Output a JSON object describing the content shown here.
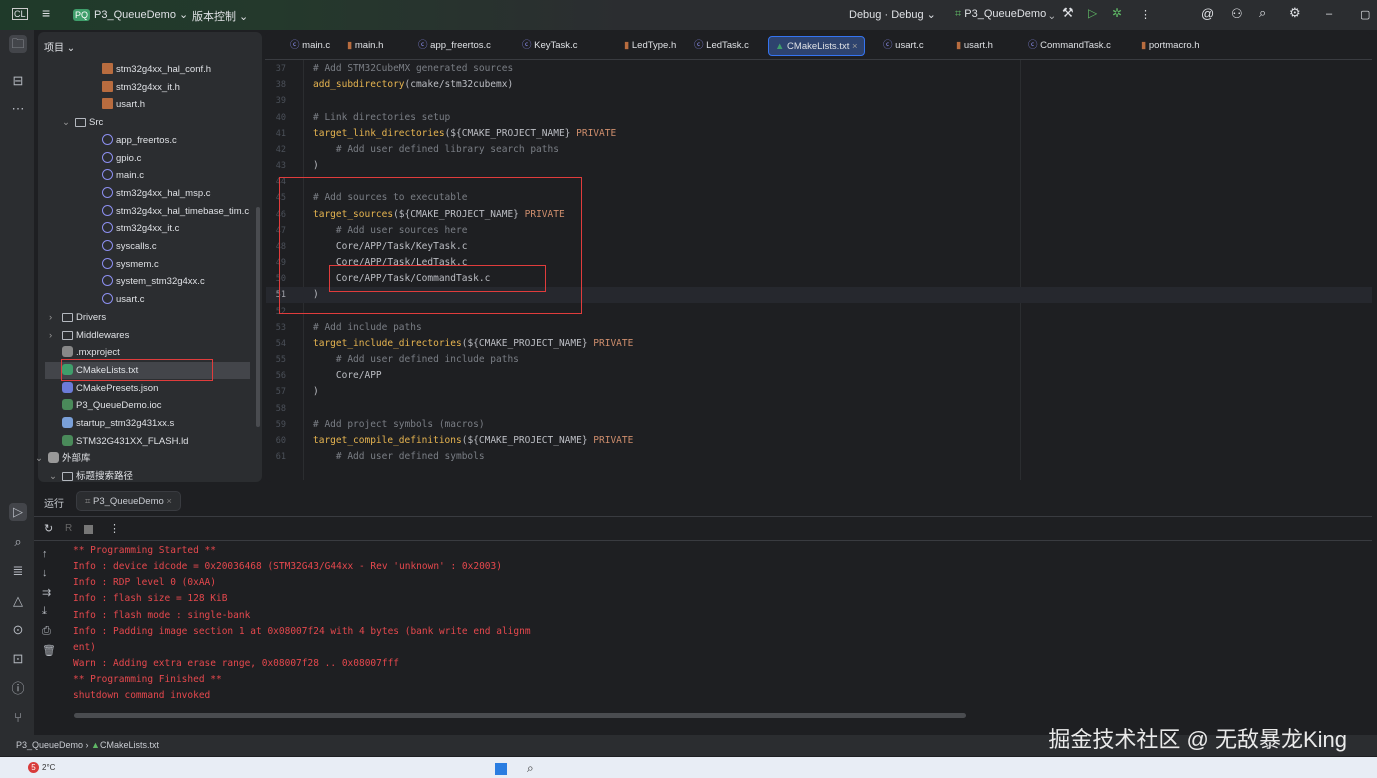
{
  "titlebar": {
    "project": "P3_QueueDemo",
    "vcs": "版本控制",
    "config": "Debug · Debug",
    "run_target": "P3_QueueDemo"
  },
  "project_panel": {
    "title": "项目",
    "items": [
      {
        "label": "stm32g4xx_hal_conf.h",
        "type": "h",
        "indent": 3
      },
      {
        "label": "stm32g4xx_it.h",
        "type": "h",
        "indent": 3
      },
      {
        "label": "usart.h",
        "type": "h",
        "indent": 3
      },
      {
        "label": "Src",
        "type": "folder",
        "indent": 2,
        "expanded": true
      },
      {
        "label": "app_freertos.c",
        "type": "c",
        "indent": 3
      },
      {
        "label": "gpio.c",
        "type": "c",
        "indent": 3
      },
      {
        "label": "main.c",
        "type": "c",
        "indent": 3
      },
      {
        "label": "stm32g4xx_hal_msp.c",
        "type": "c",
        "indent": 3
      },
      {
        "label": "stm32g4xx_hal_timebase_tim.c",
        "type": "c",
        "indent": 3
      },
      {
        "label": "stm32g4xx_it.c",
        "type": "c",
        "indent": 3
      },
      {
        "label": "syscalls.c",
        "type": "c",
        "indent": 3
      },
      {
        "label": "sysmem.c",
        "type": "c",
        "indent": 3
      },
      {
        "label": "system_stm32g4xx.c",
        "type": "c",
        "indent": 3
      },
      {
        "label": "usart.c",
        "type": "c",
        "indent": 3
      },
      {
        "label": "Drivers",
        "type": "folder",
        "indent": 1,
        "expanded": false
      },
      {
        "label": "Middlewares",
        "type": "folder",
        "indent": 1,
        "expanded": false
      },
      {
        "label": ".mxproject",
        "type": "text",
        "indent": 1
      },
      {
        "label": "CMakeLists.txt",
        "type": "cmake",
        "indent": 1,
        "selected": true
      },
      {
        "label": "CMakePresets.json",
        "type": "json",
        "indent": 1
      },
      {
        "label": "P3_QueueDemo.ioc",
        "type": "ioc",
        "indent": 1
      },
      {
        "label": "startup_stm32g431xx.s",
        "type": "asm",
        "indent": 1
      },
      {
        "label": "STM32G431XX_FLASH.ld",
        "type": "ld",
        "indent": 1
      },
      {
        "label": "外部库",
        "type": "lib",
        "indent": 0,
        "expanded": true
      },
      {
        "label": "标题搜索路径",
        "type": "folder",
        "indent": 1,
        "expanded": true
      }
    ]
  },
  "tabs": [
    {
      "label": "main.c",
      "type": "c"
    },
    {
      "label": "main.h",
      "type": "h"
    },
    {
      "label": "app_freertos.c",
      "type": "c"
    },
    {
      "label": "KeyTask.c",
      "type": "c"
    },
    {
      "label": "LedType.h",
      "type": "h"
    },
    {
      "label": "LedTask.c",
      "type": "c"
    },
    {
      "label": "CMakeLists.txt",
      "type": "cmake",
      "active": true
    },
    {
      "label": "usart.c",
      "type": "c"
    },
    {
      "label": "usart.h",
      "type": "h"
    },
    {
      "label": "CommandTask.c",
      "type": "c"
    },
    {
      "label": "portmacro.h",
      "type": "h"
    }
  ],
  "code": [
    {
      "n": "37",
      "parts": [
        [
          "cm",
          "# Add STM32CubeMX generated sources"
        ]
      ]
    },
    {
      "n": "38",
      "parts": [
        [
          "fn",
          "add_subdirectory"
        ],
        [
          "",
          "(cmake/stm32cubemx)"
        ]
      ]
    },
    {
      "n": "39",
      "parts": []
    },
    {
      "n": "40",
      "parts": [
        [
          "cm",
          "# Link directories setup"
        ]
      ]
    },
    {
      "n": "41",
      "parts": [
        [
          "fn",
          "target_link_directories"
        ],
        [
          "",
          "(${CMAKE_PROJECT_NAME} "
        ],
        [
          "kw",
          "PRIVATE"
        ]
      ]
    },
    {
      "n": "42",
      "parts": [
        [
          "cm",
          "    # Add user defined library search paths"
        ]
      ]
    },
    {
      "n": "43",
      "parts": [
        [
          "",
          ")"
        ]
      ]
    },
    {
      "n": "44",
      "parts": []
    },
    {
      "n": "45",
      "parts": [
        [
          "cm",
          "# Add sources to executable"
        ]
      ]
    },
    {
      "n": "46",
      "parts": [
        [
          "fn",
          "target_sources"
        ],
        [
          "",
          "(${CMAKE_PROJECT_NAME} "
        ],
        [
          "kw",
          "PRIVATE"
        ]
      ]
    },
    {
      "n": "47",
      "parts": [
        [
          "cm",
          "    # Add user sources here"
        ]
      ]
    },
    {
      "n": "48",
      "parts": [
        [
          "",
          "    Core/APP/Task/KeyTask.c"
        ]
      ]
    },
    {
      "n": "49",
      "parts": [
        [
          "",
          "    Core/APP/Task/LedTask.c"
        ]
      ]
    },
    {
      "n": "50",
      "parts": [
        [
          "",
          "    Core/APP/Task/CommandTask.c"
        ]
      ]
    },
    {
      "n": "51",
      "parts": [
        [
          "",
          ")"
        ]
      ]
    },
    {
      "n": "52",
      "parts": []
    },
    {
      "n": "53",
      "parts": [
        [
          "cm",
          "# Add include paths"
        ]
      ]
    },
    {
      "n": "54",
      "parts": [
        [
          "fn",
          "target_include_directories"
        ],
        [
          "",
          "(${CMAKE_PROJECT_NAME} "
        ],
        [
          "kw",
          "PRIVATE"
        ]
      ]
    },
    {
      "n": "55",
      "parts": [
        [
          "cm",
          "    # Add user defined include paths"
        ]
      ]
    },
    {
      "n": "56",
      "parts": [
        [
          "",
          "    Core/APP"
        ]
      ]
    },
    {
      "n": "57",
      "parts": [
        [
          "",
          ")"
        ]
      ]
    },
    {
      "n": "58",
      "parts": []
    },
    {
      "n": "59",
      "parts": [
        [
          "cm",
          "# Add project symbols (macros)"
        ]
      ]
    },
    {
      "n": "60",
      "parts": [
        [
          "fn",
          "target_compile_definitions"
        ],
        [
          "",
          "(${CMAKE_PROJECT_NAME} "
        ],
        [
          "kw",
          "PRIVATE"
        ]
      ]
    },
    {
      "n": "61",
      "parts": [
        [
          "cm",
          "    # Add user defined symbols"
        ]
      ]
    }
  ],
  "run_panel": {
    "title": "运行",
    "tab": "P3_QueueDemo",
    "console": [
      "** Programming Started **",
      "Info : device idcode = 0x20036468 (STM32G43/G44xx - Rev 'unknown' : 0x2003)",
      "Info : RDP level 0 (0xAA)",
      "Info : flash size = 128 KiB",
      "Info : flash mode : single-bank",
      "Info : Padding image section 1 at 0x08007f24 with 4 bytes (bank write end alignm",
      "ent)",
      "Warn : Adding extra erase range, 0x08007f28 .. 0x08007fff",
      "** Programming Finished **",
      "shutdown command invoked"
    ]
  },
  "statusbar": {
    "breadcrumb": [
      "P3_QueueDemo",
      "CMakeLists.txt"
    ]
  },
  "taskbar": {
    "badge": "5",
    "weather": "2°C"
  },
  "watermark": "掘金技术社区 @ 无敌暴龙King",
  "colors": {
    "highlight_box": "#e03c3c",
    "console_text": "#e5484d",
    "active_tab": "#2e436e"
  }
}
